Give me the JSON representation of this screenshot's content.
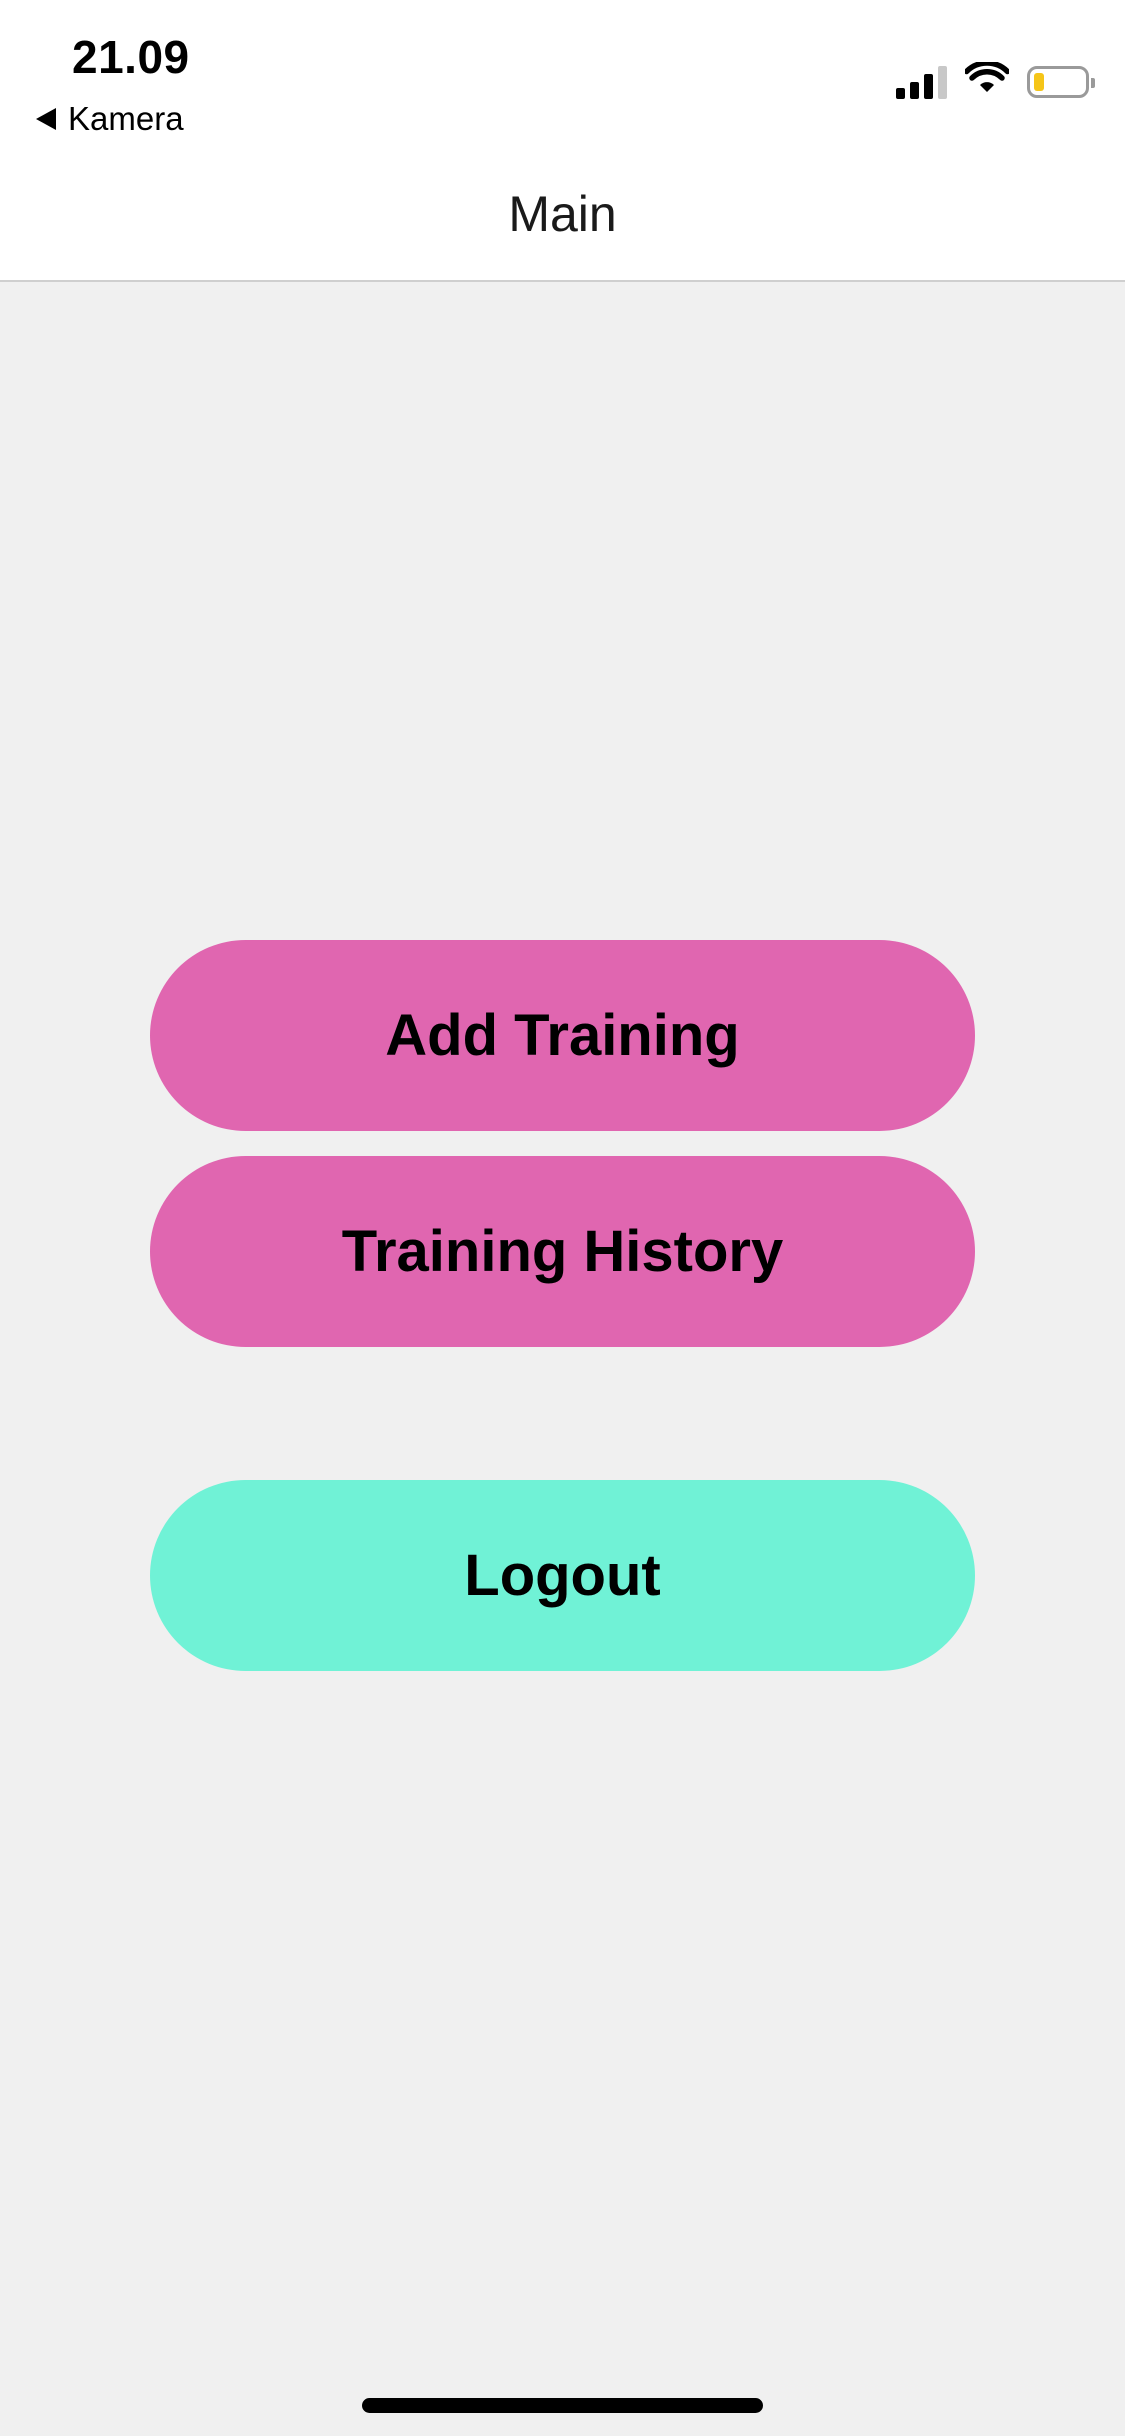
{
  "status_bar": {
    "time": "21.09",
    "back_app_label": "Kamera",
    "signal_icon": "cellular-signal-icon",
    "wifi_icon": "wifi-icon",
    "battery_icon": "battery-icon",
    "battery_level": 0.2,
    "battery_color": "#f5c518"
  },
  "header": {
    "title": "Main"
  },
  "buttons": {
    "add_training": {
      "label": "Add Training",
      "color": "#e066b0"
    },
    "training_history": {
      "label": "Training History",
      "color": "#e066b0"
    },
    "logout": {
      "label": "Logout",
      "color": "#70f2d6"
    }
  },
  "colors": {
    "background": "#f0f0f0",
    "header_background": "#ffffff"
  }
}
